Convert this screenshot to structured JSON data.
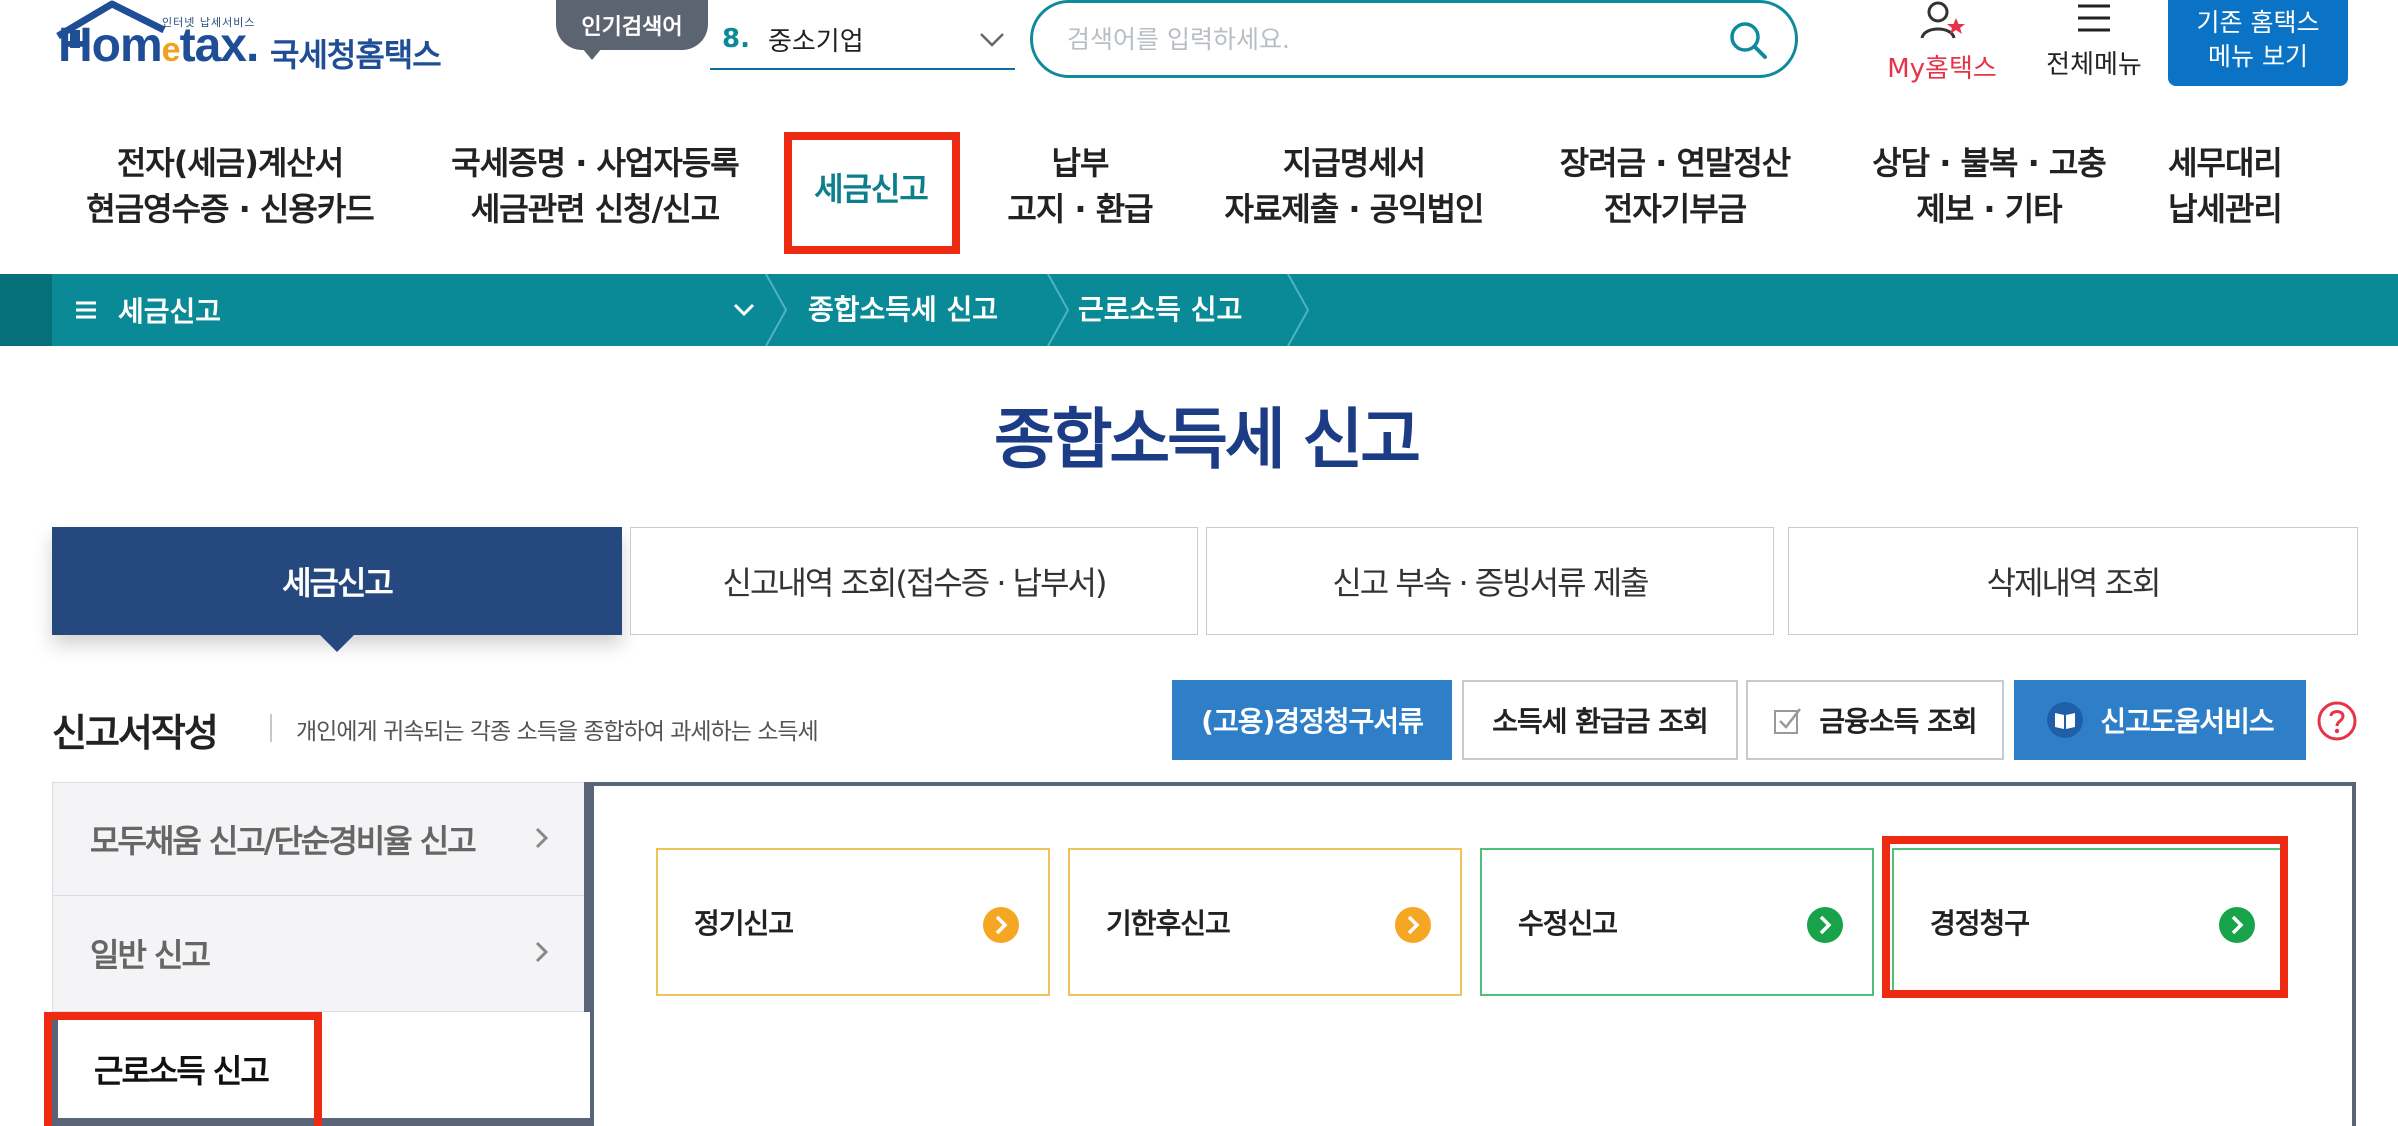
{
  "header": {
    "logo_tagline": "인터넷 납세서비스",
    "logo_home": "Hom",
    "logo_e": "e",
    "logo_tax": "tax.",
    "logo_korean": "국세청홈택스",
    "popular_badge": "인기검색어",
    "popular_rank": "8.",
    "popular_keyword": "중소기업",
    "search_placeholder": "검색어를 입력하세요.",
    "my_hometax": "My홈택스",
    "all_menu": "전체메뉴",
    "legacy_line1": "기존 홈택스",
    "legacy_line2": "메뉴 보기"
  },
  "gnb": [
    {
      "line1": "전자(세금)계산서",
      "line2": "현금영수증 · 신용카드"
    },
    {
      "line1": "국세증명 · 사업자등록",
      "line2": "세금관련 신청/신고"
    },
    {
      "line1": "세금신고",
      "line2": ""
    },
    {
      "line1": "납부",
      "line2": "고지 · 환급"
    },
    {
      "line1": "지급명세서",
      "line2": "자료제출 · 공익법인"
    },
    {
      "line1": "장려금 · 연말정산",
      "line2": "전자기부금"
    },
    {
      "line1": "상담 · 불복 · 고충",
      "line2": "제보 · 기타"
    },
    {
      "line1": "세무대리",
      "line2": "납세관리"
    }
  ],
  "breadcrumb": {
    "home": "세금신고",
    "level1": "종합소득세 신고",
    "level2": "근로소득 신고"
  },
  "page_title": "종합소득세 신고",
  "tabs": [
    "세금신고",
    "신고내역 조회(접수증 · 납부서)",
    "신고 부속 · 증빙서류 제출",
    "삭제내역 조회"
  ],
  "section": {
    "title": "신고서작성",
    "description": "개인에게 귀속되는 각종 소득을 종합하여 과세하는 소득세"
  },
  "action_buttons": {
    "claim_docs": "(고용)경정청구서류",
    "refund": "소득세 환급금 조회",
    "financial": "금융소득 조회",
    "help_service": "신고도움서비스"
  },
  "left_menu": [
    "모두채움 신고/단순경비율 신고",
    "일반 신고",
    "근로소득 신고"
  ],
  "cards": [
    "정기신고",
    "기한후신고",
    "수정신고",
    "경정청구"
  ],
  "colors": {
    "brand_blue": "#1f4e96",
    "teal": "#0a8a96",
    "navy_tab": "#25497f",
    "action_blue": "#2f7fc8",
    "highlight_red": "#ee2a12",
    "orange_go": "#f5a623",
    "green_go": "#17a34a"
  }
}
